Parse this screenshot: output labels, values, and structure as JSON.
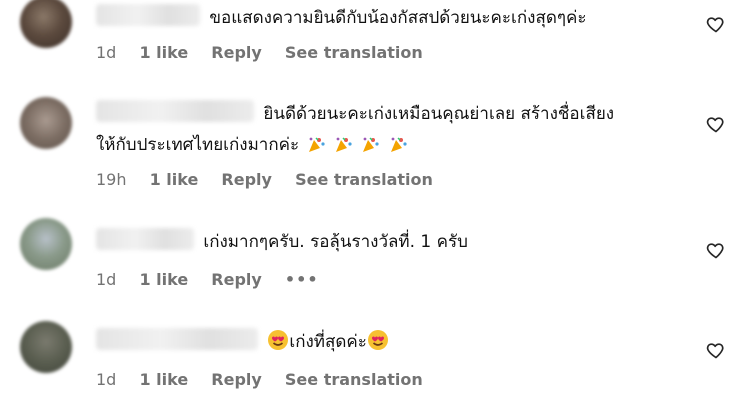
{
  "icons": {
    "heart": "heart-outline-icon",
    "celebrate": "party-popper-emoji",
    "love_eyes": "heart-eyes-emoji",
    "more": "more-dots-icon"
  },
  "colors": {
    "text": "#111111",
    "meta": "#737373",
    "background": "#ffffff"
  },
  "comments": [
    {
      "text": "ขอแสดงความยินดีกับน้องกัสสปด้วยนะคะเก่งสุดๆค่ะ",
      "time": "1d",
      "likes": "1 like",
      "reply": "Reply",
      "translation": "See translation"
    },
    {
      "text_line1": "ยินดีด้วยนะคะเก่งเหมือนคุณย่าเลย สร้างชื่อเสียง",
      "text_line2": "ให้กับประเทศไทยเก่งมากค่ะ",
      "time": "19h",
      "likes": "1 like",
      "reply": "Reply",
      "translation": "See translation"
    },
    {
      "text": "เก่งมากๆครับ. รอลุ้นรางวัลที่. 1 ครับ",
      "time": "1d",
      "likes": "1 like",
      "reply": "Reply",
      "more": "•••"
    },
    {
      "text": "เก่งที่สุดค่ะ",
      "time": "1d",
      "likes": "1 like",
      "reply": "Reply",
      "translation": "See translation"
    }
  ]
}
